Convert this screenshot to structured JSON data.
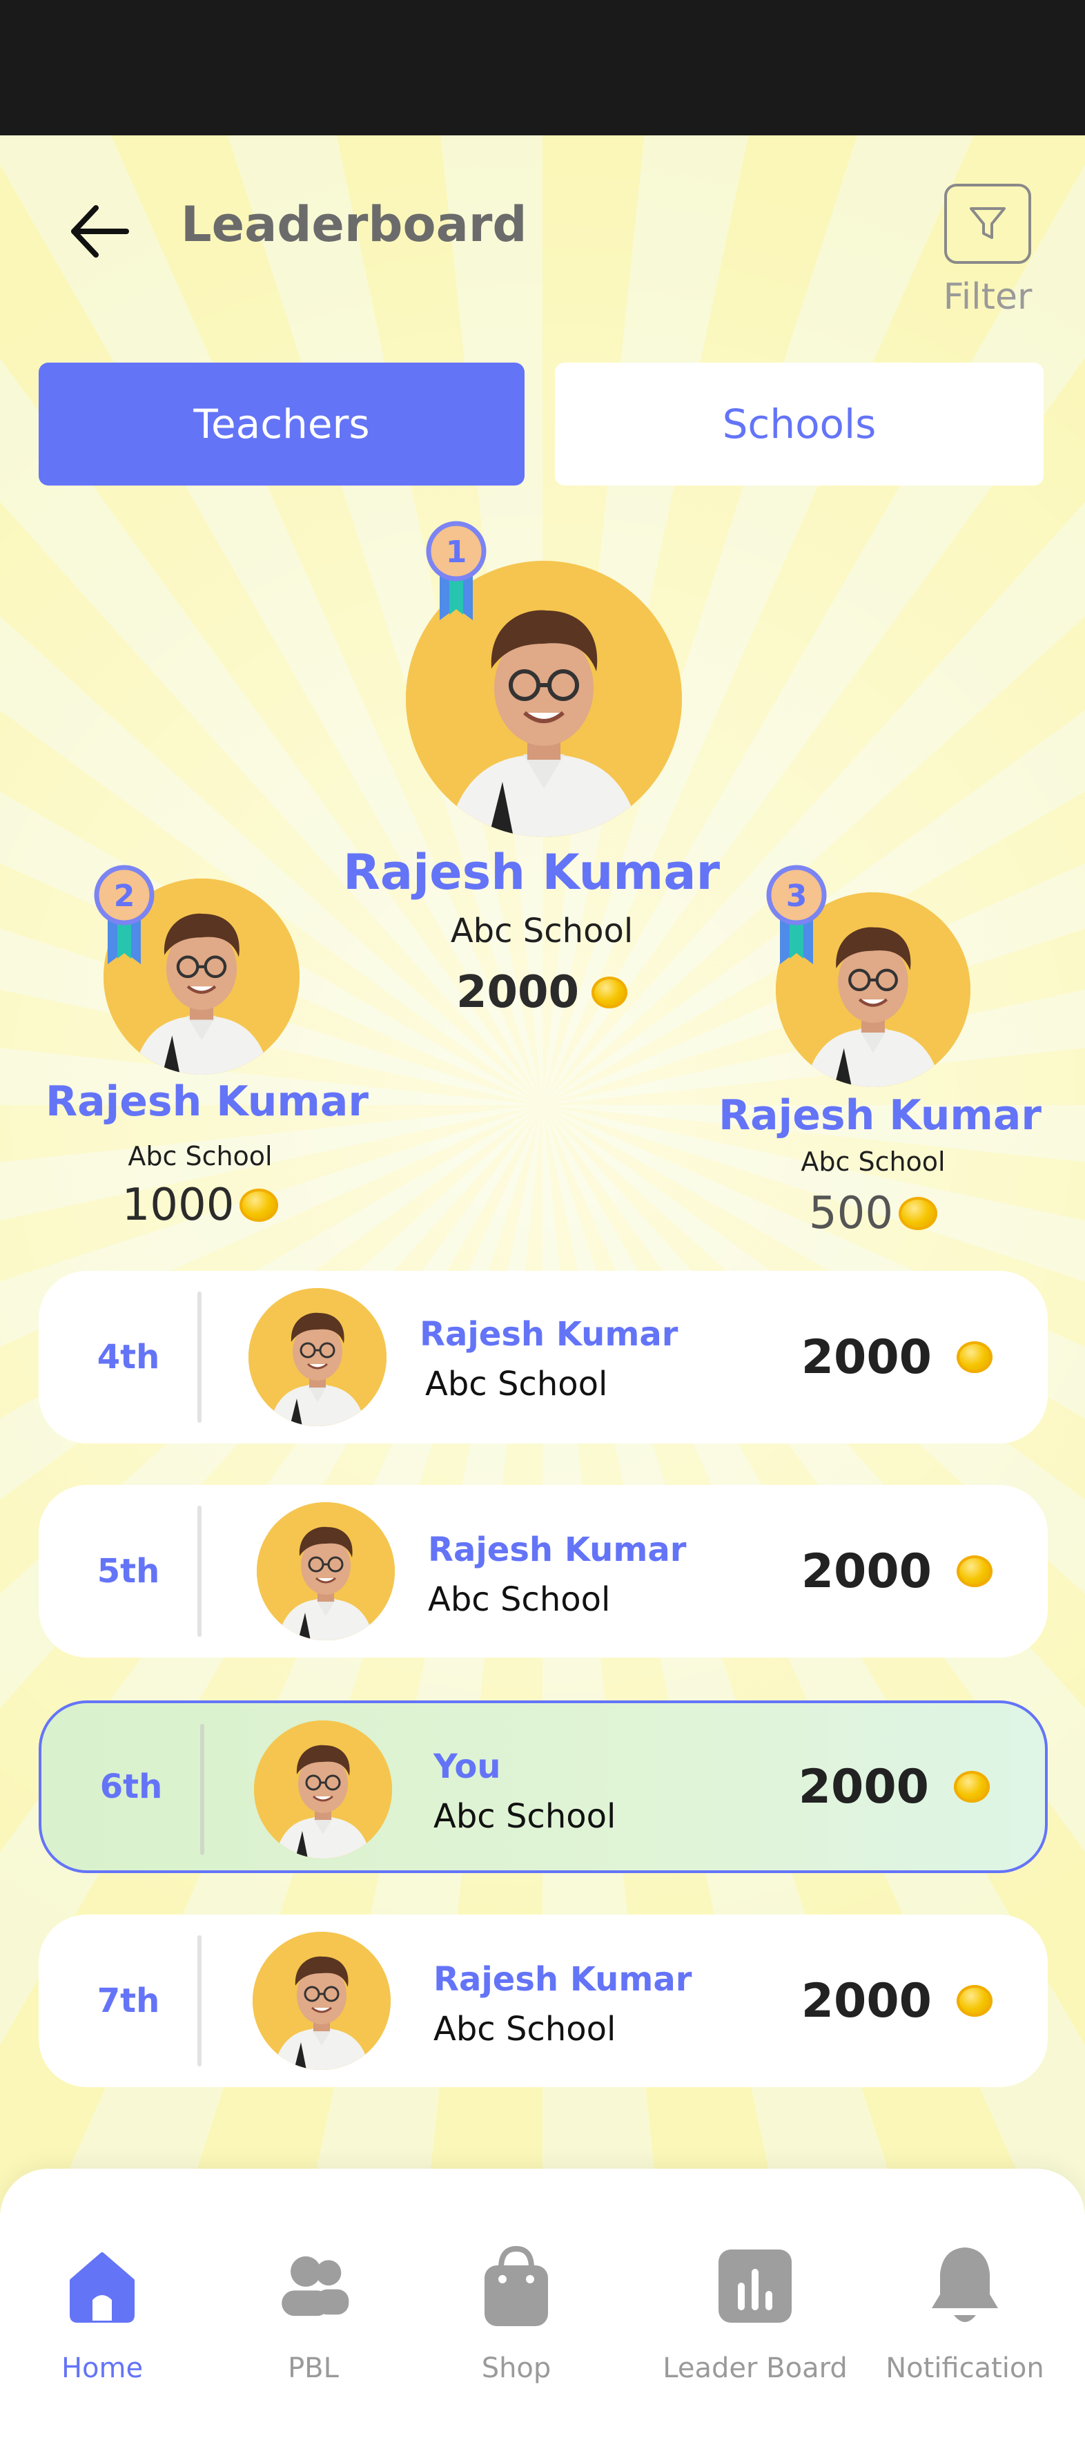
{
  "header": {
    "title": "Leaderboard",
    "filter_label": "Filter"
  },
  "tabs": [
    {
      "label": "Teachers",
      "active": true
    },
    {
      "label": "Schools",
      "active": false
    }
  ],
  "podium": {
    "first": {
      "rank": "1",
      "name": "Rajesh Kumar",
      "school": "Abc School",
      "points": "2000"
    },
    "second": {
      "rank": "2",
      "name": "Rajesh Kumar",
      "school": "Abc School",
      "points": "1000"
    },
    "third": {
      "rank": "3",
      "name": "Rajesh Kumar",
      "school": "Abc School",
      "points": "500"
    }
  },
  "ranks": [
    {
      "position": "4th",
      "name": "Rajesh Kumar",
      "school": "Abc School",
      "points": "2000",
      "is_me": false
    },
    {
      "position": "5th",
      "name": "Rajesh Kumar",
      "school": "Abc School",
      "points": "2000",
      "is_me": false
    },
    {
      "position": "6th",
      "name": "You",
      "school": "Abc School",
      "points": "2000",
      "is_me": true
    },
    {
      "position": "7th",
      "name": "Rajesh Kumar",
      "school": "Abc School",
      "points": "2000",
      "is_me": false
    }
  ],
  "nav": [
    {
      "label": "Home",
      "icon": "home-icon",
      "active": true
    },
    {
      "label": "PBL",
      "icon": "users-icon",
      "active": false
    },
    {
      "label": "Shop",
      "icon": "shopping-bag-icon",
      "active": false
    },
    {
      "label": "Leader Board",
      "icon": "bar-chart-icon",
      "active": false
    },
    {
      "label": "Notification",
      "icon": "bell-icon",
      "active": false
    }
  ],
  "colors": {
    "accent": "#6474f7",
    "avatar_bg": "#f5c54f",
    "coin": "#f6c400",
    "me_row": "#dff3d6"
  }
}
